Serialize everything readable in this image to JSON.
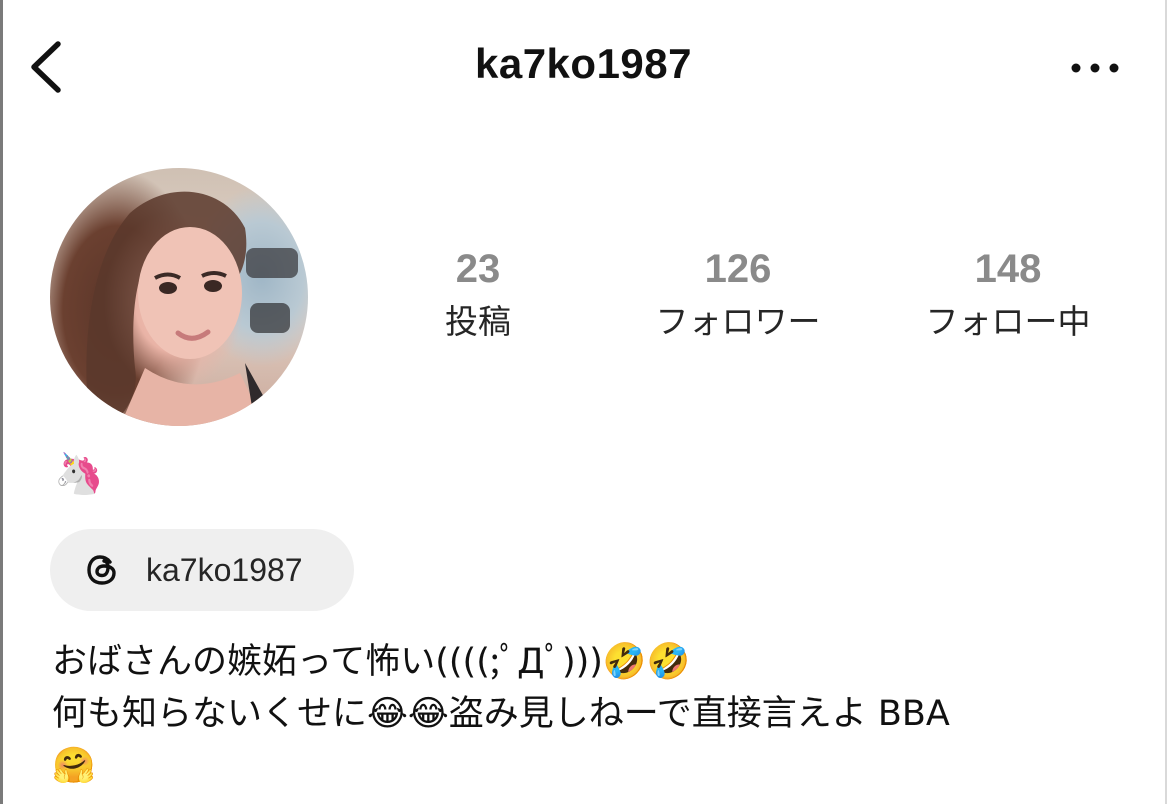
{
  "header": {
    "username": "ka7ko1987",
    "back_icon": "chevron-left-icon",
    "more_icon": "more-horizontal-icon"
  },
  "profile": {
    "avatar_alt": "profile photo"
  },
  "stats": {
    "posts": {
      "count": "23",
      "label": "投稿"
    },
    "followers": {
      "count": "126",
      "label": "フォロワー"
    },
    "following": {
      "count": "148",
      "label": "フォロー中"
    }
  },
  "name_emoji": "🦄",
  "threads": {
    "icon": "threads-icon",
    "handle": "ka7ko1987"
  },
  "bio": {
    "line1": "おばさんの嫉妬って怖い((((;ﾟДﾟ)))🤣🤣",
    "line2": "何も知らないくせに😂😂盗み見しねーで直接言えよ BBA",
    "line3": "🤗"
  },
  "colors": {
    "stat_number": "#8a8a8a",
    "pill_background": "#efefef",
    "text": "#111111"
  }
}
